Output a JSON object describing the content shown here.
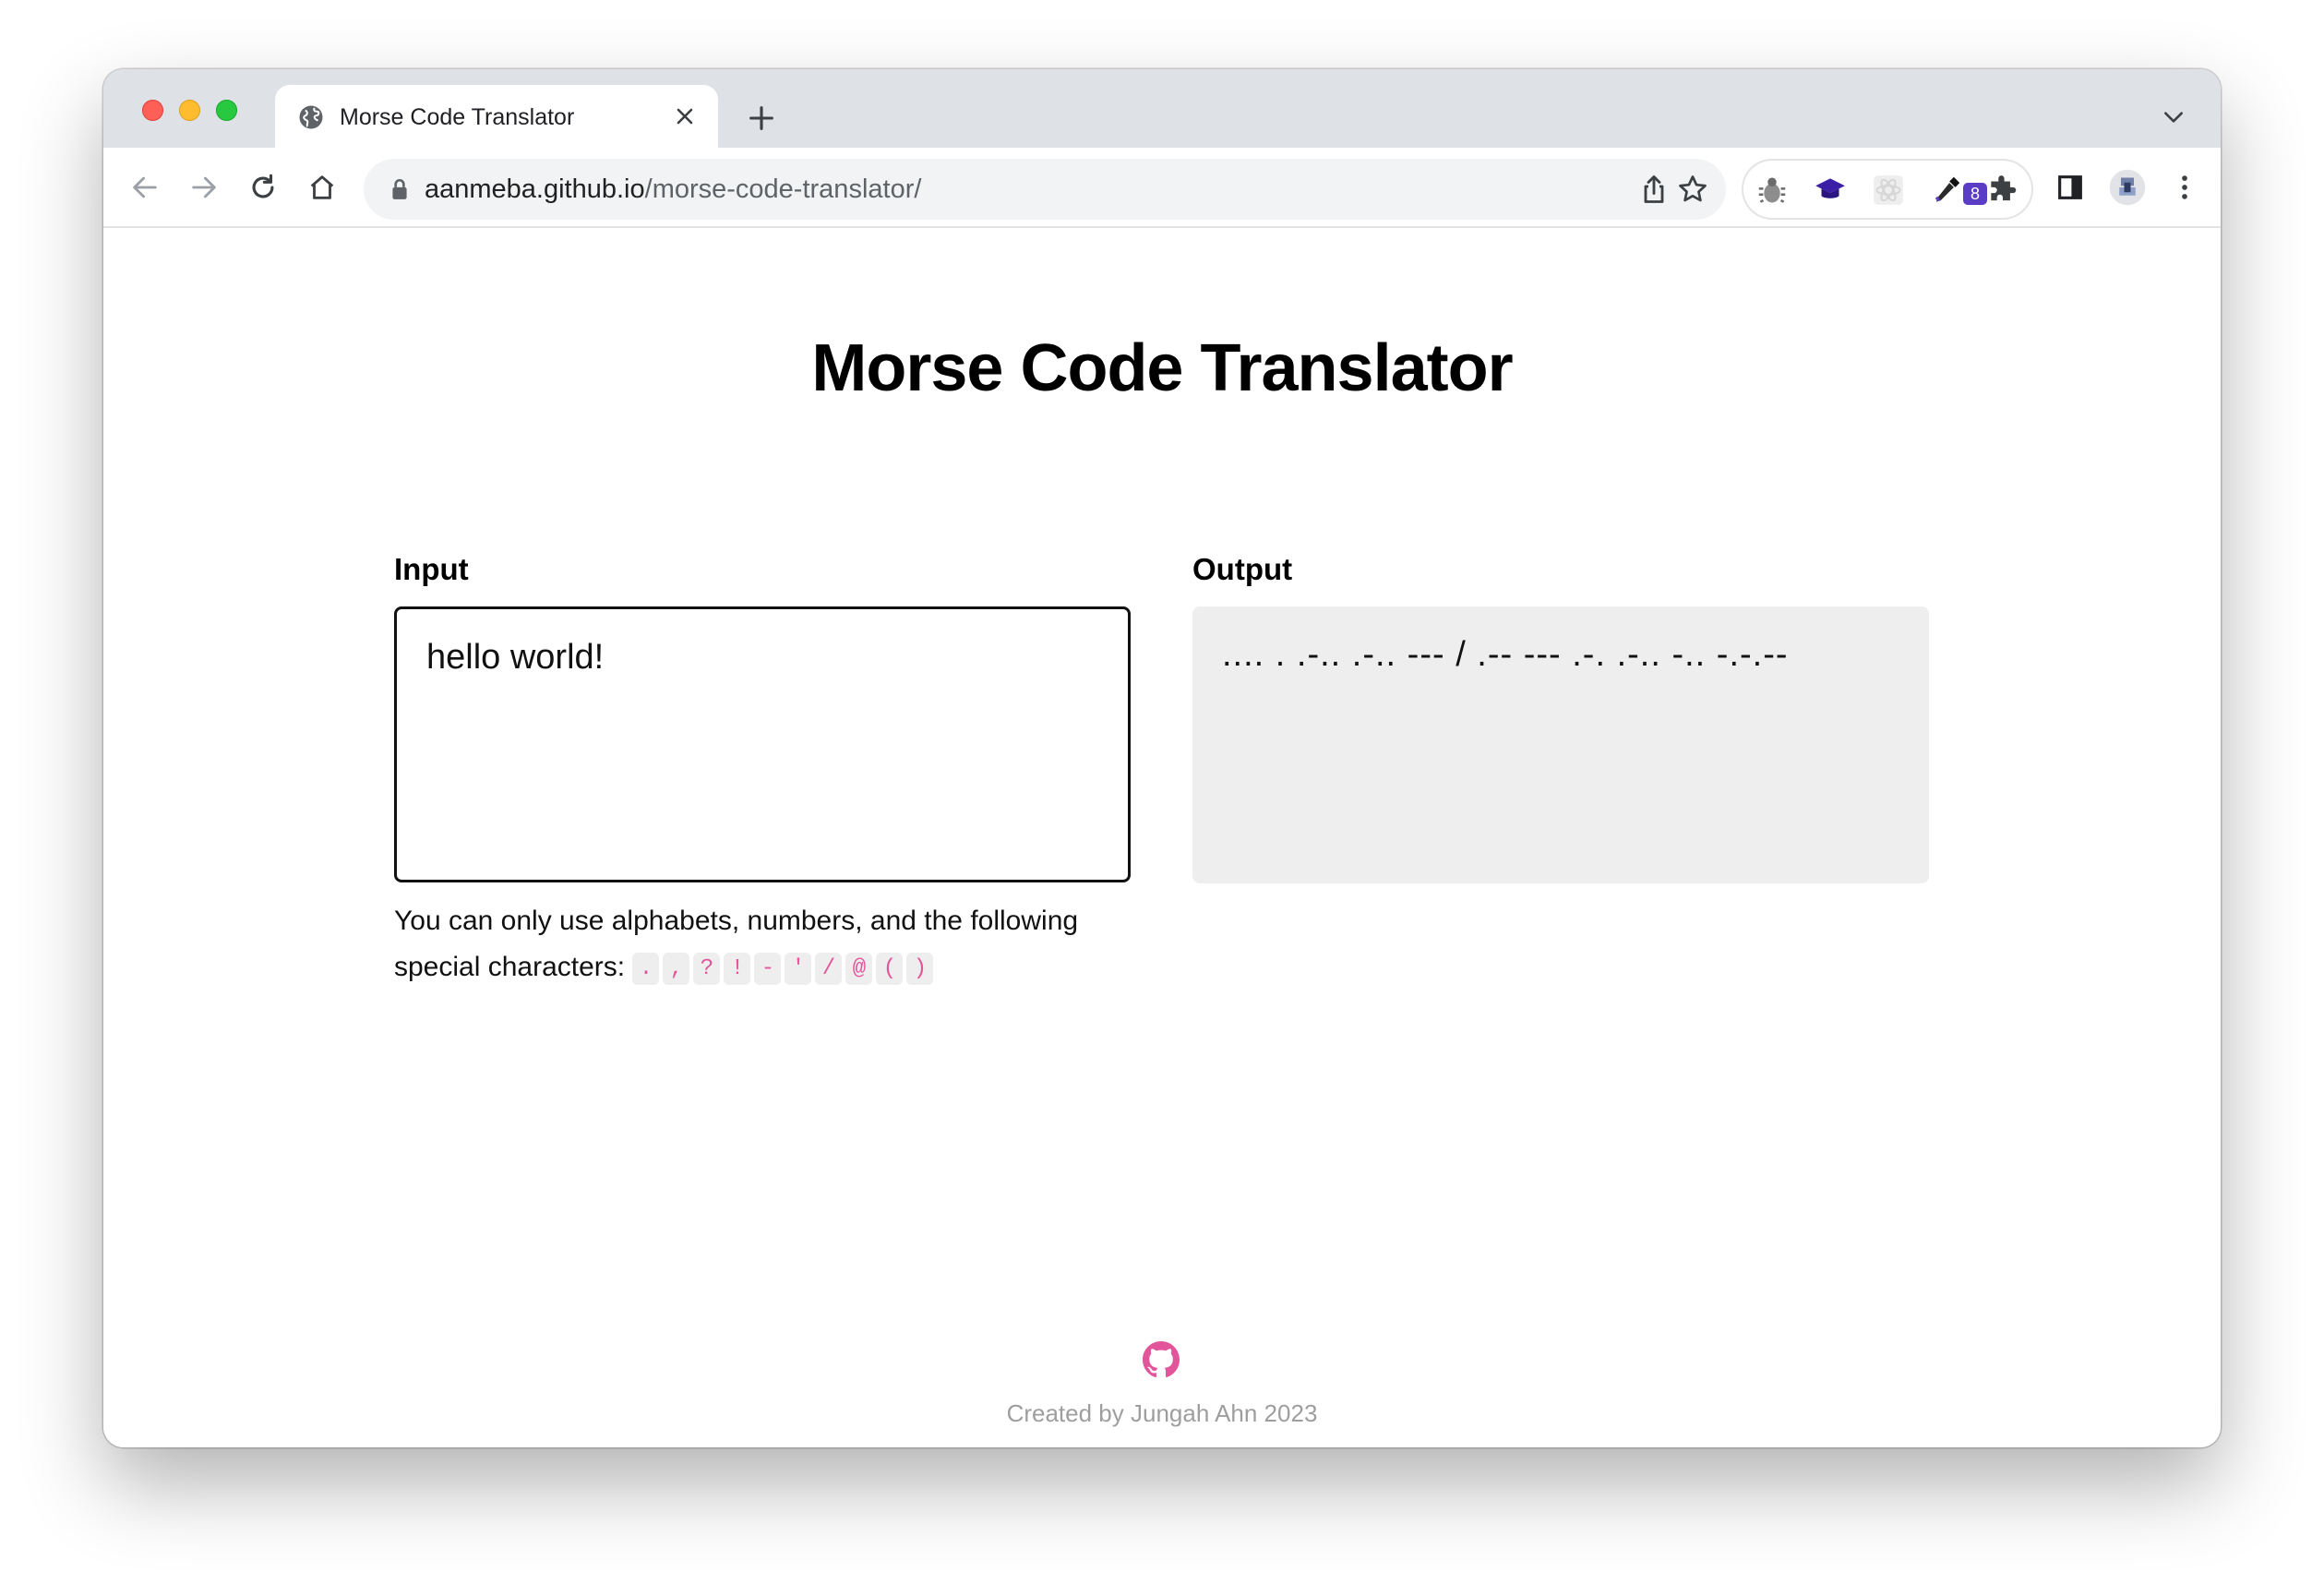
{
  "browser": {
    "tab": {
      "title": "Morse Code Translator",
      "icon": "globe-icon"
    },
    "url": {
      "host": "aanmeba.github.io",
      "path": "/morse-code-translator/"
    },
    "extension_badge": "8"
  },
  "page": {
    "title": "Morse Code Translator",
    "input": {
      "label": "Input",
      "value": "hello world!"
    },
    "output": {
      "label": "Output",
      "value": ".... . .-.. .-.. --- / .-- --- .-. .-.. -.. -.-.--"
    },
    "hint": {
      "text": "You can only use alphabets, numbers, and the following special characters:",
      "chars": [
        ".",
        ",",
        "?",
        "!",
        "-",
        "'",
        "/",
        "@",
        "(",
        ")"
      ]
    },
    "footer": "Created by Jungah Ahn 2023"
  },
  "colors": {
    "accent_pink": "#e2559b",
    "output_bg": "#eeeeee",
    "footer_text": "#9e9e9e"
  }
}
